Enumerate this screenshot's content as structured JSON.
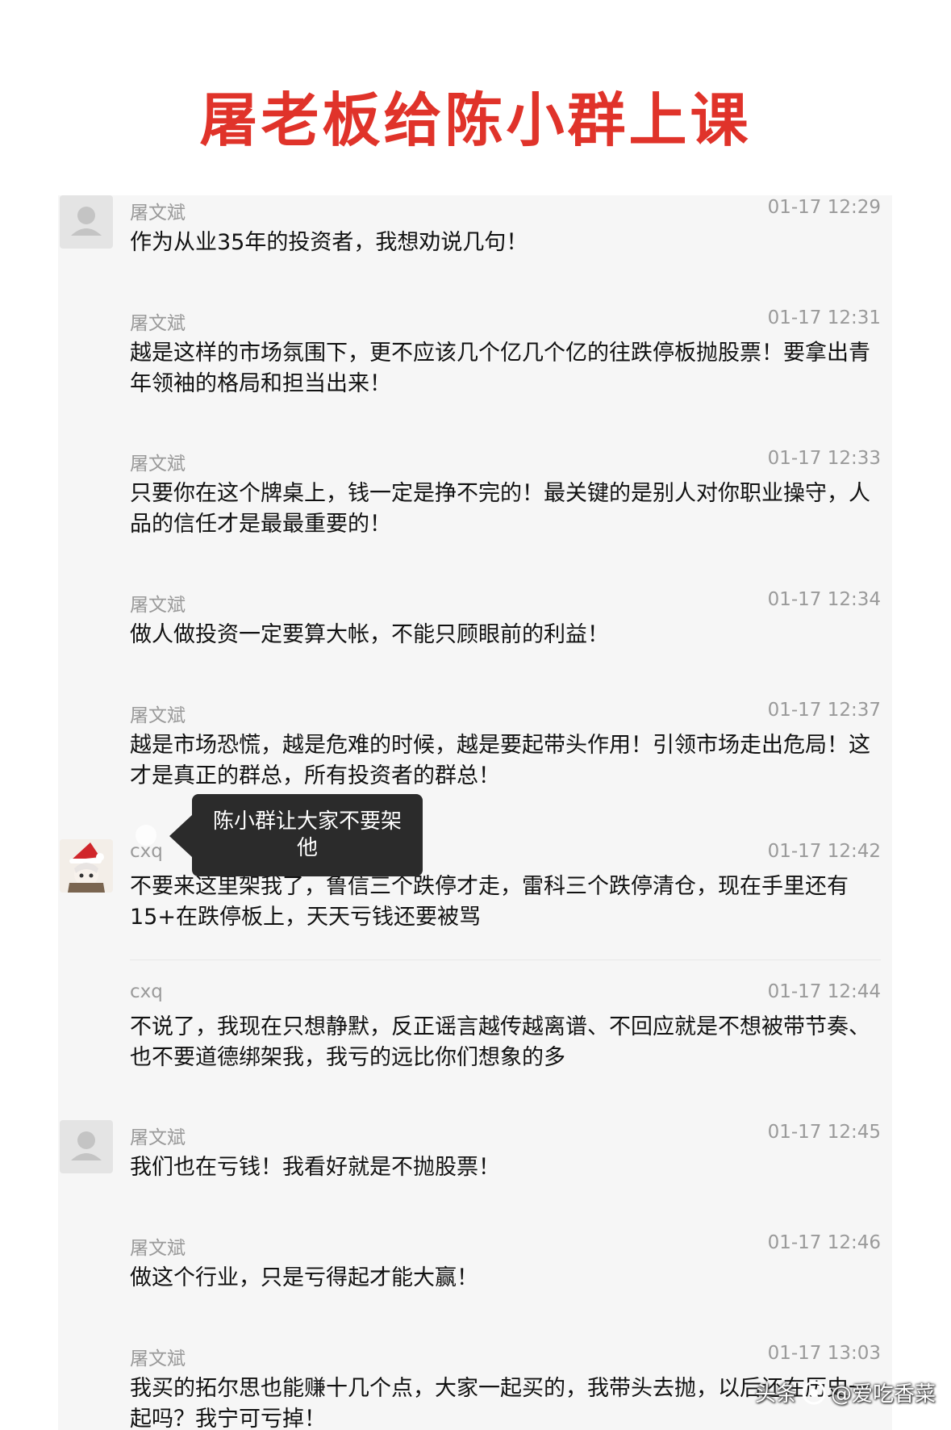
{
  "title": "屠老板给陈小群上课",
  "messages": [
    {
      "name": "屠文斌",
      "time": "01-17 12:29",
      "text": "作为从业35年的投资者，我想劝说几句！"
    },
    {
      "name": "屠文斌",
      "time": "01-17 12:31",
      "text": "越是这样的市场氛围下，更不应该几个亿几个亿的往跌停板抛股票！要拿出青年领袖的格局和担当出来！"
    },
    {
      "name": "屠文斌",
      "time": "01-17 12:33",
      "text": "只要你在这个牌桌上，钱一定是挣不完的！最关键的是别人对你职业操守，人品的信任才是最最重要的！"
    },
    {
      "name": "屠文斌",
      "time": "01-17 12:34",
      "text": "做人做投资一定要算大帐，不能只顾眼前的利益！"
    },
    {
      "name": "屠文斌",
      "time": "01-17 12:37",
      "text": "越是市场恐慌，越是危难的时候，越是要起带头作用！引领市场走出危局！这才是真正的群总，所有投资者的群总！"
    },
    {
      "name": "cxq",
      "time": "01-17 12:42",
      "text": "不要来这里架我了，鲁信三个跌停才走，雷科三个跌停清仓，现在手里还有15+在跌停板上，天天亏钱还要被骂"
    },
    {
      "name": "cxq",
      "time": "01-17 12:44",
      "text": "不说了，我现在只想静默，反正谣言越传越离谱、不回应就是不想被带节奏、也不要道德绑架我，我亏的远比你们想象的多"
    },
    {
      "name": "屠文斌",
      "time": "01-17 12:45",
      "text": "我们也在亏钱！我看好就是不抛股票！"
    },
    {
      "name": "屠文斌",
      "time": "01-17 12:46",
      "text": "做这个行业，只是亏得起才能大赢！"
    },
    {
      "name": "屠文斌",
      "time": "01-17 13:03",
      "text": "我买的拓尔思也能赚十几个点，大家一起买的，我带头去抛，以后还在历史一起吗？我宁可亏掉！"
    }
  ],
  "annotation": "陈小群让大家不要架他",
  "watermark": {
    "prefix": "头条",
    "handle": "@爱吃香菜"
  }
}
